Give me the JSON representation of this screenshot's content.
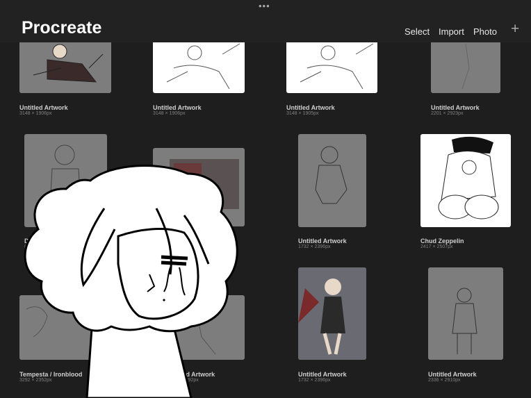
{
  "header": {
    "title": "Procreate",
    "more_icon": "more-dots-icon",
    "select_label": "Select",
    "import_label": "Import",
    "photo_label": "Photo",
    "new_icon": "plus-icon"
  },
  "gallery": [
    {
      "name": "Untitled Artwork",
      "dims": "3148 × 1906px"
    },
    {
      "name": "Untitled Artwork",
      "dims": "3148 × 1906px"
    },
    {
      "name": "Untitled Artwork",
      "dims": "3148 × 1905px"
    },
    {
      "name": "Untitled Artwork",
      "dims": "2201 × 2923px"
    },
    {
      "name": "Dol",
      "dims": "846"
    },
    {
      "name": "",
      "dims": ""
    },
    {
      "name": "Untitled Artwork",
      "dims": "1732 × 2396px"
    },
    {
      "name": "Chud Zeppelin",
      "dims": "2417 × 2507px"
    },
    {
      "name": "Tempesta / Ironblood",
      "dims": "3292 × 2352px"
    },
    {
      "name": "tled Artwork",
      "dims": "1 3292px"
    },
    {
      "name": "Untitled Artwork",
      "dims": "1732 × 2396px"
    },
    {
      "name": "Untitled Artwork",
      "dims": "2336 × 2910px"
    }
  ],
  "colors": {
    "background": "#1e1e1e",
    "header": "#222222",
    "thumb_gray": "#7d7d7d"
  }
}
